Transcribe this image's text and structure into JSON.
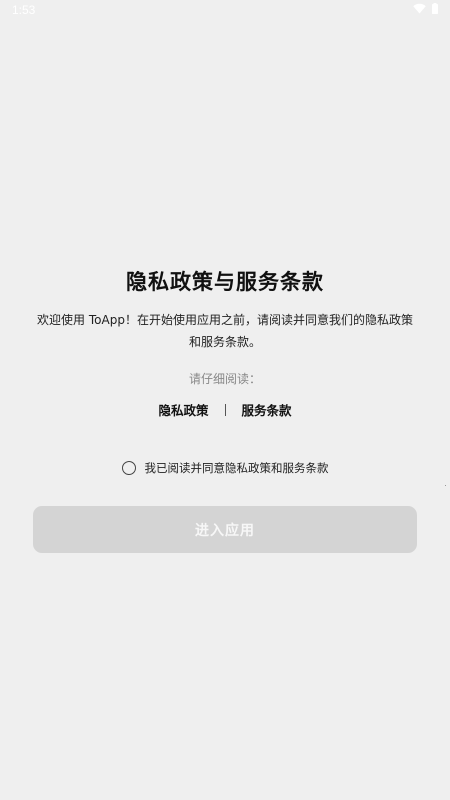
{
  "status_bar": {
    "time": "1:53",
    "icons": [
      "wifi-icon",
      "battery-icon"
    ]
  },
  "dialog": {
    "title": "隐私政策与服务条款",
    "intro": "欢迎使用 ToApp！在开始使用应用之前，请阅读并同意我们的隐私政策和服务条款。",
    "hint": "请仔细阅读：",
    "links": {
      "privacy": "隐私政策",
      "terms": "服务条款"
    },
    "agree_label": "我已阅读并同意隐私政策和服务条款",
    "agree_checked": false,
    "enter_button": "进入应用"
  },
  "colors": {
    "background": "#efefef",
    "button_disabled": "#d4d4d4",
    "button_text": "#f7f7f7",
    "hint_text": "#888888"
  }
}
